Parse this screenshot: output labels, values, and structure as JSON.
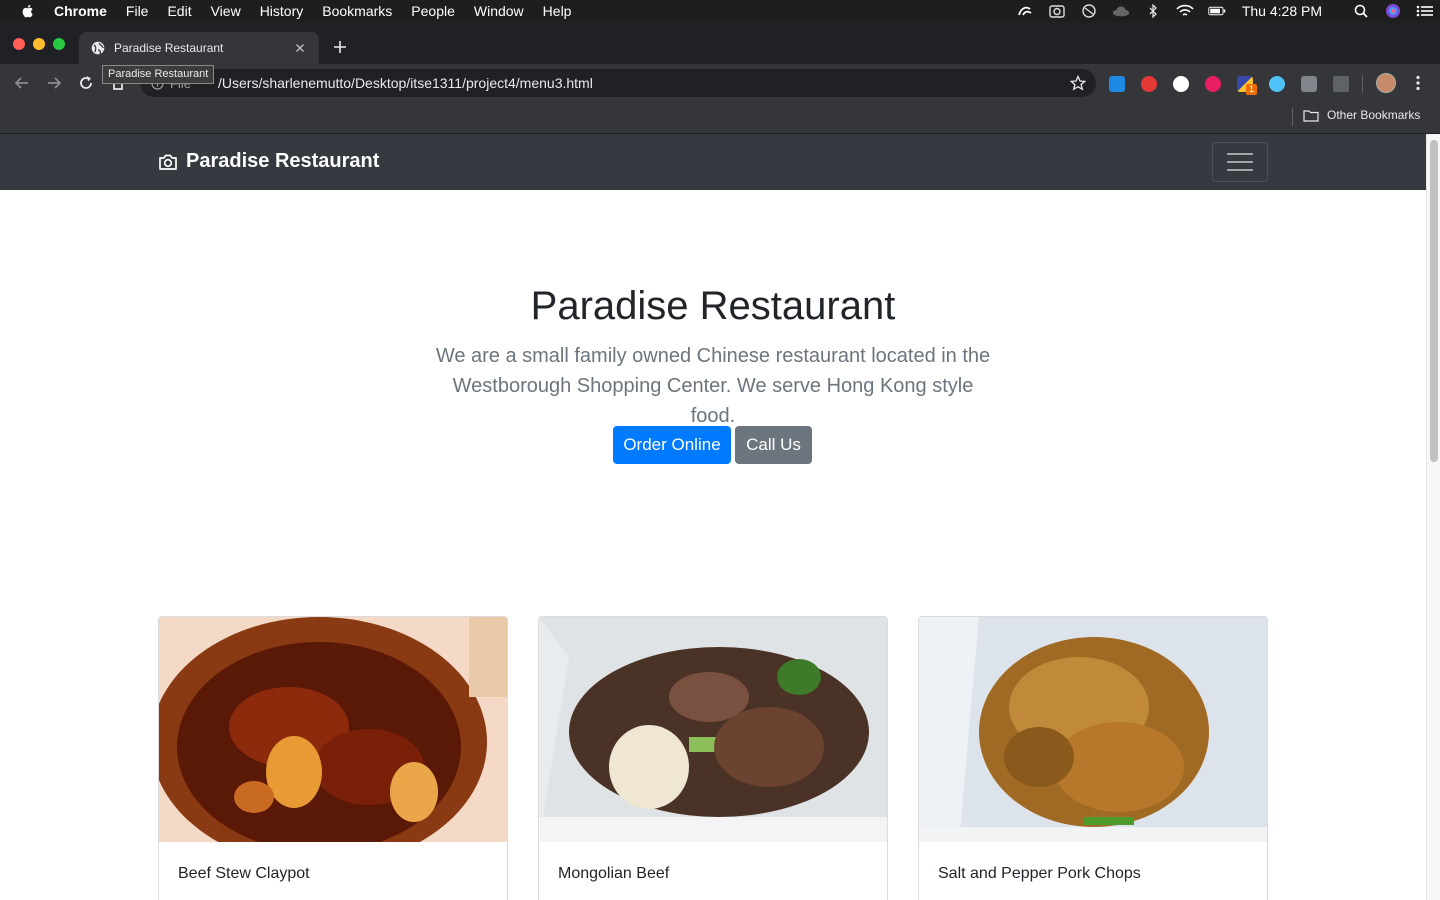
{
  "menubar": {
    "app": "Chrome",
    "items": [
      "File",
      "Edit",
      "View",
      "History",
      "Bookmarks",
      "People",
      "Window",
      "Help"
    ],
    "clock": "Thu 4:28 PM"
  },
  "browser": {
    "tab_title": "Paradise Restaurant",
    "tooltip": "Paradise Restaurant",
    "site_info_label": "File",
    "url": "/Users/sharlenemutto/Desktop/itse1311/project4/menu3.html",
    "other_bookmarks": "Other Bookmarks",
    "extension_badge": "1"
  },
  "site": {
    "brand": "Paradise Restaurant",
    "hero": {
      "title": "Paradise Restaurant",
      "lead": "We are a small family owned Chinese restaurant located in the Westborough Shopping Center. We serve Hong Kong style food.",
      "primary_button": "Order Online",
      "secondary_button": "Call Us"
    },
    "cards": [
      {
        "title": "Beef Stew Claypot"
      },
      {
        "title": "Mongolian Beef"
      },
      {
        "title": "Salt and Pepper Pork Chops"
      }
    ]
  },
  "colors": {
    "navbar": "#343a40",
    "primary": "#007bff",
    "secondary": "#6c757d"
  }
}
